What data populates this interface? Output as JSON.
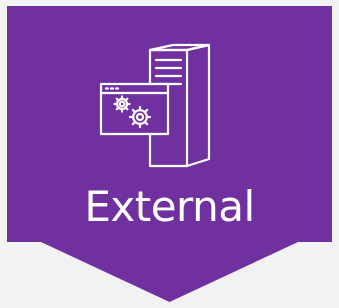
{
  "tile": {
    "label": "External",
    "icon": "server-with-application-settings-icon"
  },
  "colors": {
    "tile_background": "#7030a0",
    "icon_stroke": "#ffffff",
    "label_text": "#ffffff",
    "page_background": "#f2f2f2"
  }
}
